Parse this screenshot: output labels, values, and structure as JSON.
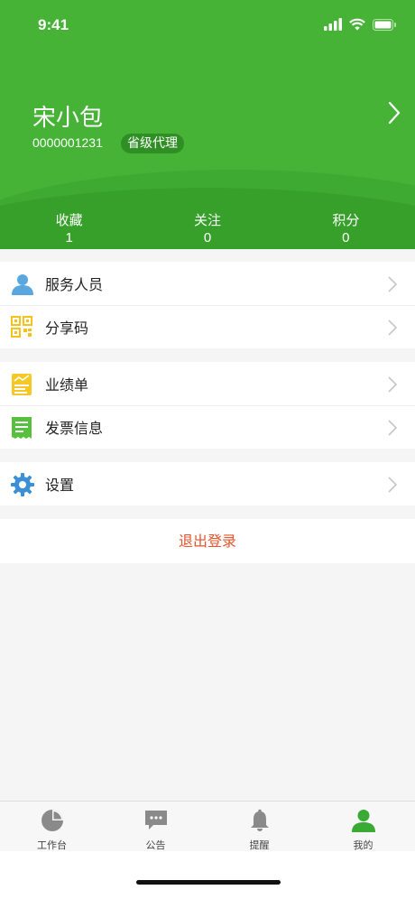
{
  "status_bar": {
    "time": "9:41"
  },
  "profile": {
    "name": "宋小包",
    "id": "0000001231",
    "role_badge": "省级代理"
  },
  "stats": [
    {
      "label": "收藏",
      "value": "1"
    },
    {
      "label": "关注",
      "value": "0"
    },
    {
      "label": "积分",
      "value": "0"
    }
  ],
  "menu_groups": [
    [
      {
        "label": "服务人员",
        "icon": "person-icon"
      },
      {
        "label": "分享码",
        "icon": "qr-code-icon"
      }
    ],
    [
      {
        "label": "业绩单",
        "icon": "chart-document-icon"
      },
      {
        "label": "发票信息",
        "icon": "receipt-icon"
      }
    ],
    [
      {
        "label": "设置",
        "icon": "gear-icon"
      }
    ]
  ],
  "logout_label": "退出登录",
  "tabbar": {
    "items": [
      {
        "label": "工作台",
        "icon": "pie-chart-icon"
      },
      {
        "label": "公告",
        "icon": "chat-bubble-icon"
      },
      {
        "label": "提醒",
        "icon": "bell-icon"
      },
      {
        "label": "我的",
        "icon": "person-icon"
      }
    ],
    "active_index": 3
  },
  "colors": {
    "header_green": "#46b337",
    "active_tab": "#3aaa35",
    "logout_red": "#e5532c"
  }
}
